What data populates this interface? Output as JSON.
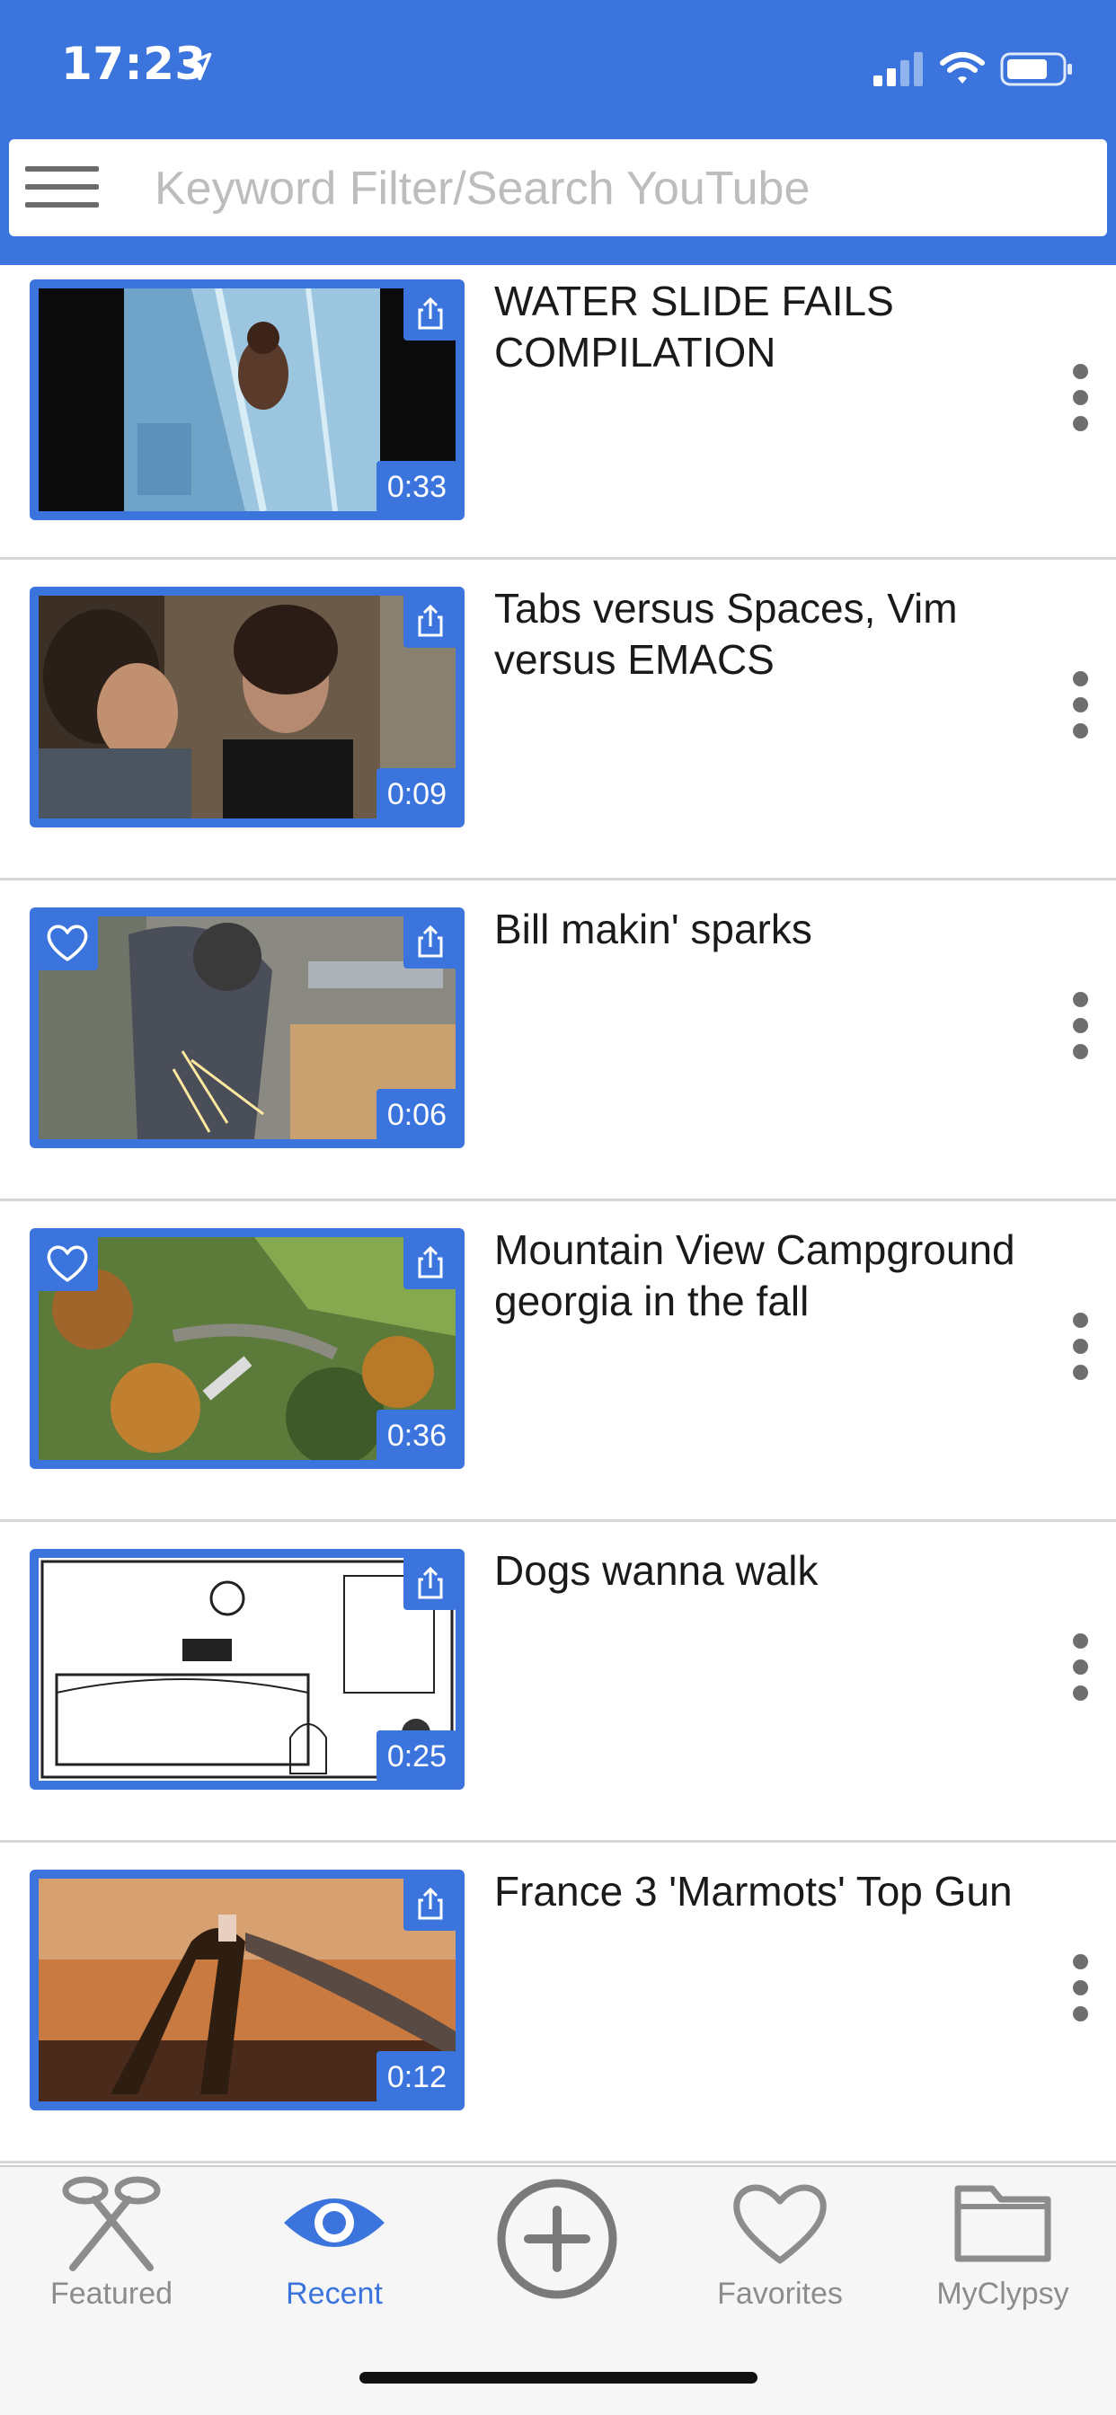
{
  "status_bar": {
    "time": "17:23"
  },
  "search": {
    "placeholder": "Keyword Filter/Search YouTube"
  },
  "videos": [
    {
      "title": "WATER SLIDE FAILS COMPILATION",
      "duration": "0:33",
      "favorited": false
    },
    {
      "title": "Tabs versus Spaces, Vim versus EMACS",
      "duration": "0:09",
      "favorited": false
    },
    {
      "title": "Bill makin' sparks",
      "duration": "0:06",
      "favorited": true
    },
    {
      "title": "Mountain View Campground georgia in the fall",
      "duration": "0:36",
      "favorited": true
    },
    {
      "title": "Dogs wanna walk",
      "duration": "0:25",
      "favorited": false
    },
    {
      "title": "France 3 'Marmots' Top Gun",
      "duration": "0:12",
      "favorited": false
    }
  ],
  "tabs": [
    {
      "label": "Featured",
      "icon": "scissors-icon",
      "active": false
    },
    {
      "label": "Recent",
      "icon": "eye-icon",
      "active": true
    },
    {
      "label": "",
      "icon": "plus-circle-icon",
      "active": false
    },
    {
      "label": "Favorites",
      "icon": "heart-icon",
      "active": false
    },
    {
      "label": "MyClypsy",
      "icon": "folder-icon",
      "active": false
    }
  ],
  "colors": {
    "accent": "#3a74dc",
    "inactive": "#8c8c8c",
    "divider": "#d6d6d6"
  }
}
